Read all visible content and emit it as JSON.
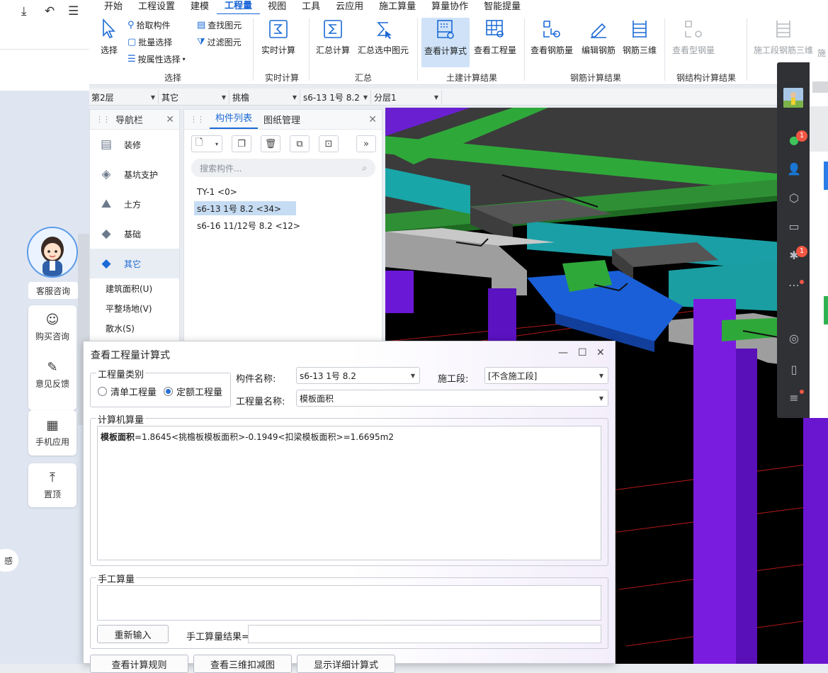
{
  "browser_toolbar": {
    "download_icon": "download-icon",
    "undo_icon": "undo-icon",
    "menu_icon": "menu-icon"
  },
  "menu": [
    "开始",
    "工程设置",
    "建模",
    "工程量",
    "视图",
    "工具",
    "云应用",
    "施工算量",
    "算量协作",
    "智能提量"
  ],
  "menu_active": "工程量",
  "ribbon": {
    "select_label": "选择",
    "pick": "拾取构件",
    "batch": "批量选择",
    "by_attr": "按属性选择",
    "find": "查找图元",
    "filter": "过滤图元",
    "realtime": "实时计算",
    "sum": "汇总计算",
    "sum_sel": "汇总选中图元",
    "view_formula": "查看计算式",
    "view_qty": "查看工程量",
    "view_rebar": "查看钢筋量",
    "edit_rebar": "编辑钢筋",
    "rebar3d": "钢筋三维",
    "view_steel": "查看型钢量",
    "stage_rebar3d": "施工段钢筋三维",
    "stage_cut": "施",
    "groups": {
      "select": "选择",
      "realtime": "实时计算",
      "summary": "汇总",
      "civil": "土建计算结果",
      "rebar": "钢筋计算结果",
      "steel": "钢结构计算结果"
    }
  },
  "selectors": {
    "floor": "第2层",
    "category": "其它",
    "type": "挑檐",
    "component": "s6-13 1号 8.2",
    "layer": "分层1"
  },
  "nav": {
    "title": "导航栏",
    "items": [
      "装修",
      "基坑支护",
      "土方",
      "基础",
      "其它"
    ],
    "selected": "其它",
    "sub": [
      "建筑面积(U)",
      "平整场地(V)",
      "散水(S)"
    ]
  },
  "comp_panel": {
    "tab_list": "构件列表",
    "tab_drawing": "图纸管理",
    "search_placeholder": "搜索构件...",
    "items": [
      "TY-1 <0>",
      "s6-13 1号 8.2 <34>",
      "s6-16 11/12号 8.2 <12>"
    ],
    "selected_index": 1
  },
  "left_web": {
    "service": "客服咨询",
    "buy": "购买咨询",
    "feedback": "意见反馈",
    "mobile": "手机应用",
    "top": "置顶",
    "feeling_partial": "感"
  },
  "im": {
    "chat_badge": "1",
    "moment_badge": "1"
  },
  "dialog": {
    "title": "查看工程量计算式",
    "qty_type_legend": "工程量类别",
    "radio_list": "清单工程量",
    "radio_quota": "定额工程量",
    "radio_selected": "定额工程量",
    "comp_name_label": "构件名称:",
    "comp_name_value": "s6-13 1号 8.2",
    "stage_label": "施工段:",
    "stage_value": "[不含施工段]",
    "qty_name_label": "工程量名称:",
    "qty_name_value": "模板面积",
    "machine_legend": "计算机算量",
    "formula_bold": "模板面积",
    "formula_rest": "=1.8645<挑檐板模板面积>-0.1949<扣梁模板面积>=1.6695m2",
    "manual_legend": "手工算量",
    "reinput": "重新输入",
    "manual_result_label": "手工算量结果=",
    "btn_rules": "查看计算规则",
    "btn_3d": "查看三维扣减图",
    "btn_detail": "显示详细计算式"
  }
}
